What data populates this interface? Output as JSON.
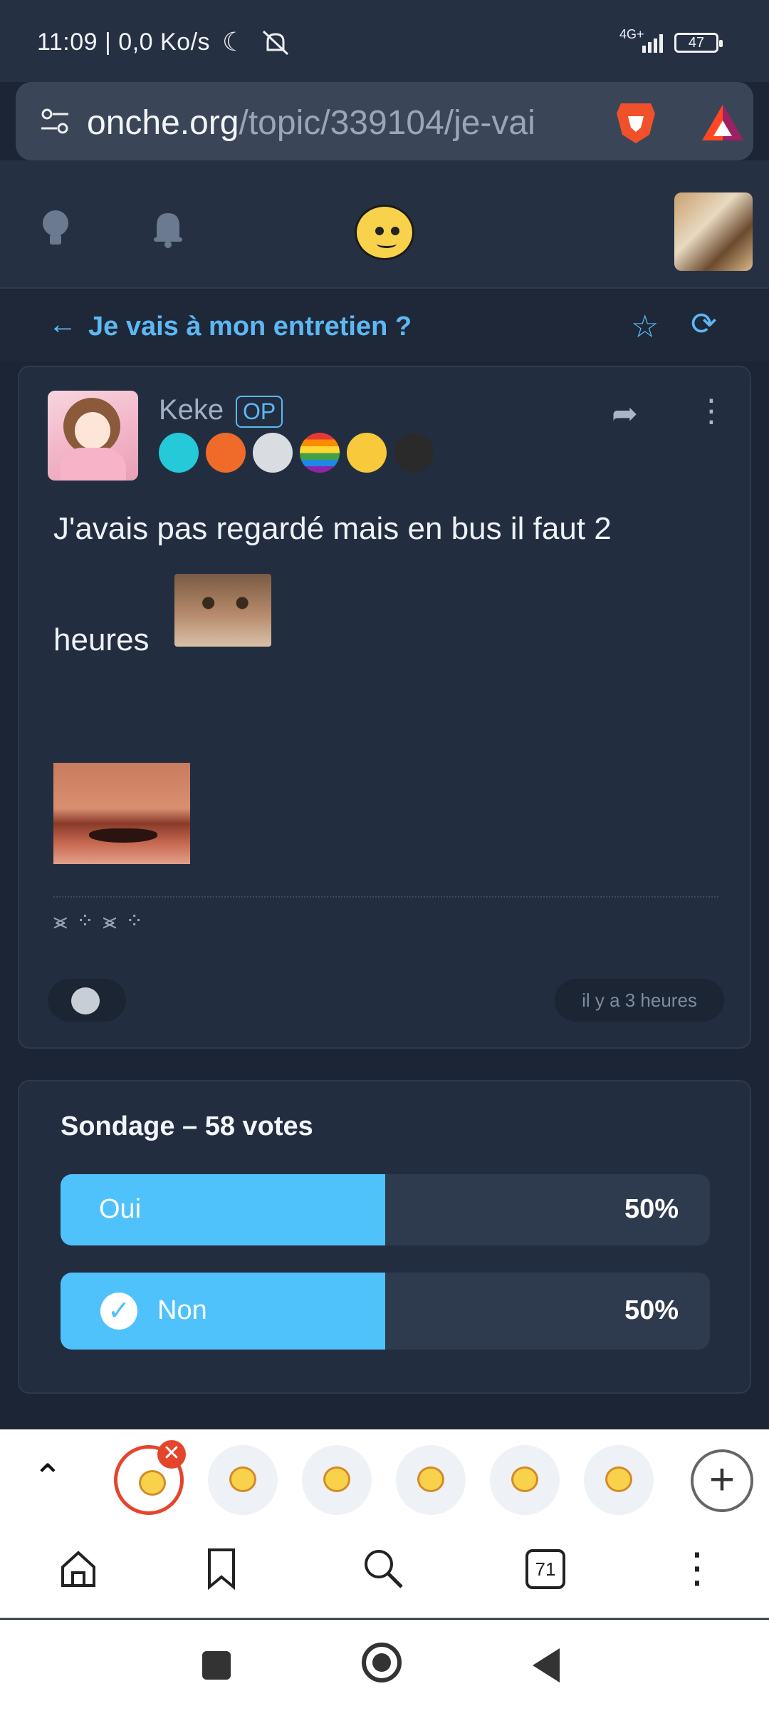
{
  "status_bar": {
    "time": "11:09 | 0,0 Ko/s",
    "network": "4G+",
    "battery": "47"
  },
  "browser": {
    "url_domain": "onche.org",
    "url_path": "/topic/339104/je-vai"
  },
  "topic": {
    "back_glyph": "←",
    "title": "Je vais à mon entretien ?"
  },
  "post": {
    "username": "Keke",
    "op_badge": "OP",
    "text_line1": "J'avais pas regardé mais en bus il faut 2",
    "text_line2": "heures",
    "signature": "⪤ ⁘ ⪤ ⁘",
    "timestamp": "il y a 3 heures",
    "badges": [
      "stars-badge",
      "rooster-badge",
      "harold-badge",
      "rainbow-badge",
      "smiley-badge",
      "zero-tout-badge"
    ]
  },
  "poll": {
    "title": "Sondage – 58 votes",
    "options": [
      {
        "label": "Oui",
        "percent": "50%",
        "fraction": 0.5,
        "selected": false
      },
      {
        "label": "Non",
        "percent": "50%",
        "fraction": 0.5,
        "selected": true
      }
    ]
  },
  "tabs": {
    "count": 6,
    "active_index": 0
  },
  "bottom_nav": {
    "tab_count": "71"
  },
  "colors": {
    "accent": "#5db8f2",
    "poll_fill": "#4fc1fb",
    "background": "#1b2535",
    "close_red": "#e4452b"
  }
}
